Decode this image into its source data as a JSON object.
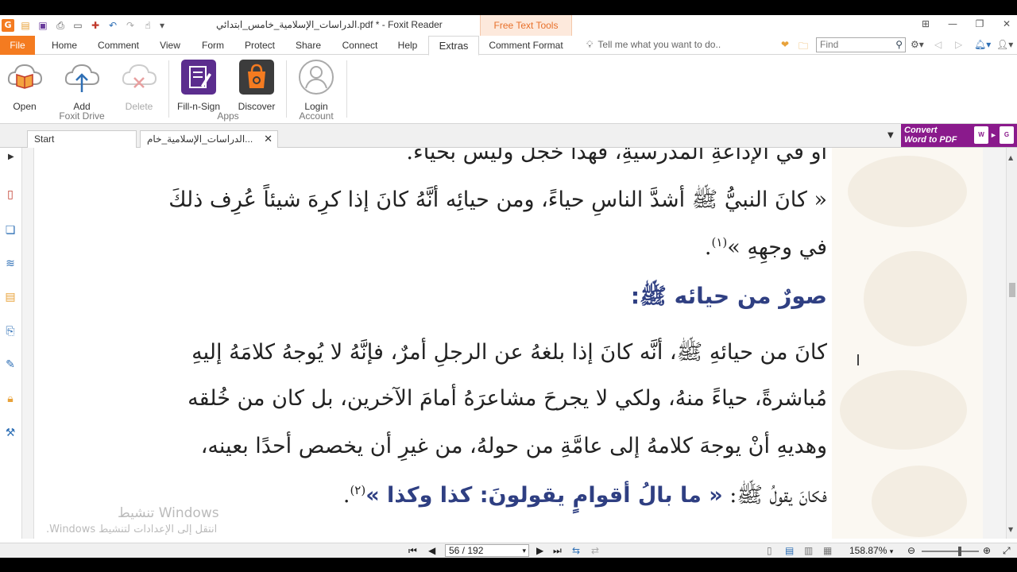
{
  "window": {
    "title": "الدراسات_الإسلامية_خامس_ابتدائي.pdf * - Foxit Reader",
    "contextual_tab": "Free Text Tools"
  },
  "quick_access": [
    "foxit-logo-icon",
    "open-icon",
    "save-icon",
    "print-icon",
    "new-window-icon",
    "new-icon",
    "undo-icon",
    "redo-icon",
    "hand-icon"
  ],
  "tabs": [
    {
      "label": "File"
    },
    {
      "label": "Home"
    },
    {
      "label": "Comment"
    },
    {
      "label": "View"
    },
    {
      "label": "Form"
    },
    {
      "label": "Protect"
    },
    {
      "label": "Share"
    },
    {
      "label": "Connect"
    },
    {
      "label": "Help"
    },
    {
      "label": "Extras"
    },
    {
      "label": "Comment Format"
    }
  ],
  "tell_me": "Tell me what you want to do..",
  "find_placeholder": "Find",
  "ribbon": {
    "open": "Open",
    "add": "Add",
    "delete": "Delete",
    "foxit_drive": "Foxit Drive",
    "fill_sign": "Fill-n-Sign",
    "discover": "Discover",
    "apps": "Apps",
    "login": "Login",
    "account": "Account"
  },
  "doc_tabs": {
    "start": "Start",
    "doc": "الدراسات_الإسلامية_خام..."
  },
  "convert": {
    "line1": "Convert",
    "line2": "Word to PDF"
  },
  "content": {
    "line0": "او في الإذاعةِ المدرسيةِ، فهذا خجل وليس بحياء.",
    "line1": "« كانَ النبيُّ ﷺ أشدَّ الناسِ حياءً، ومن حيائِه أنَّهُ كانَ إذا كرِهَ شيئاً عُرِف ذلكَ",
    "line2a": "في وجهِهِ »",
    "line2b": "(١)",
    "line2c": ".",
    "heading": "صورٌ من حيائه ﷺ:",
    "line3": "كانَ من حيائهِ ﷺ، أنَّه كانَ إذا بلغهُ عن الرجلِ أمرٌ، فإنَّهُ لا يُوجهُ كلامَهُ إليهِ",
    "line4": "مُباشرةً، حياءً منهُ، ولكي لا يجرحَ مشاعرَهُ أمامَ الآخرين، بل كان من خُلقه",
    "line5": "وهديهِ أنْ يوجهَ كلامهُ إلى عامَّةِ من حولهُ، من غيرِ أن يخصص أحدًا بعينه،",
    "line6a": "فكانَ يقولُ ﷺ: ",
    "line6b": "« ما بالُ أقوامٍ يقولونَ: كذا وكذا »",
    "line6c": "(٢)",
    "line6d": "."
  },
  "watermark": {
    "line1": "تنشيط Windows",
    "line2": "انتقل إلى الإعدادات لتنشيط Windows."
  },
  "status": {
    "page": "56 / 192",
    "zoom": "158.87%"
  },
  "colors": {
    "accent_orange": "#f47b20",
    "heading_blue": "#2f3f82",
    "convert_purple": "#8a1a8c"
  }
}
